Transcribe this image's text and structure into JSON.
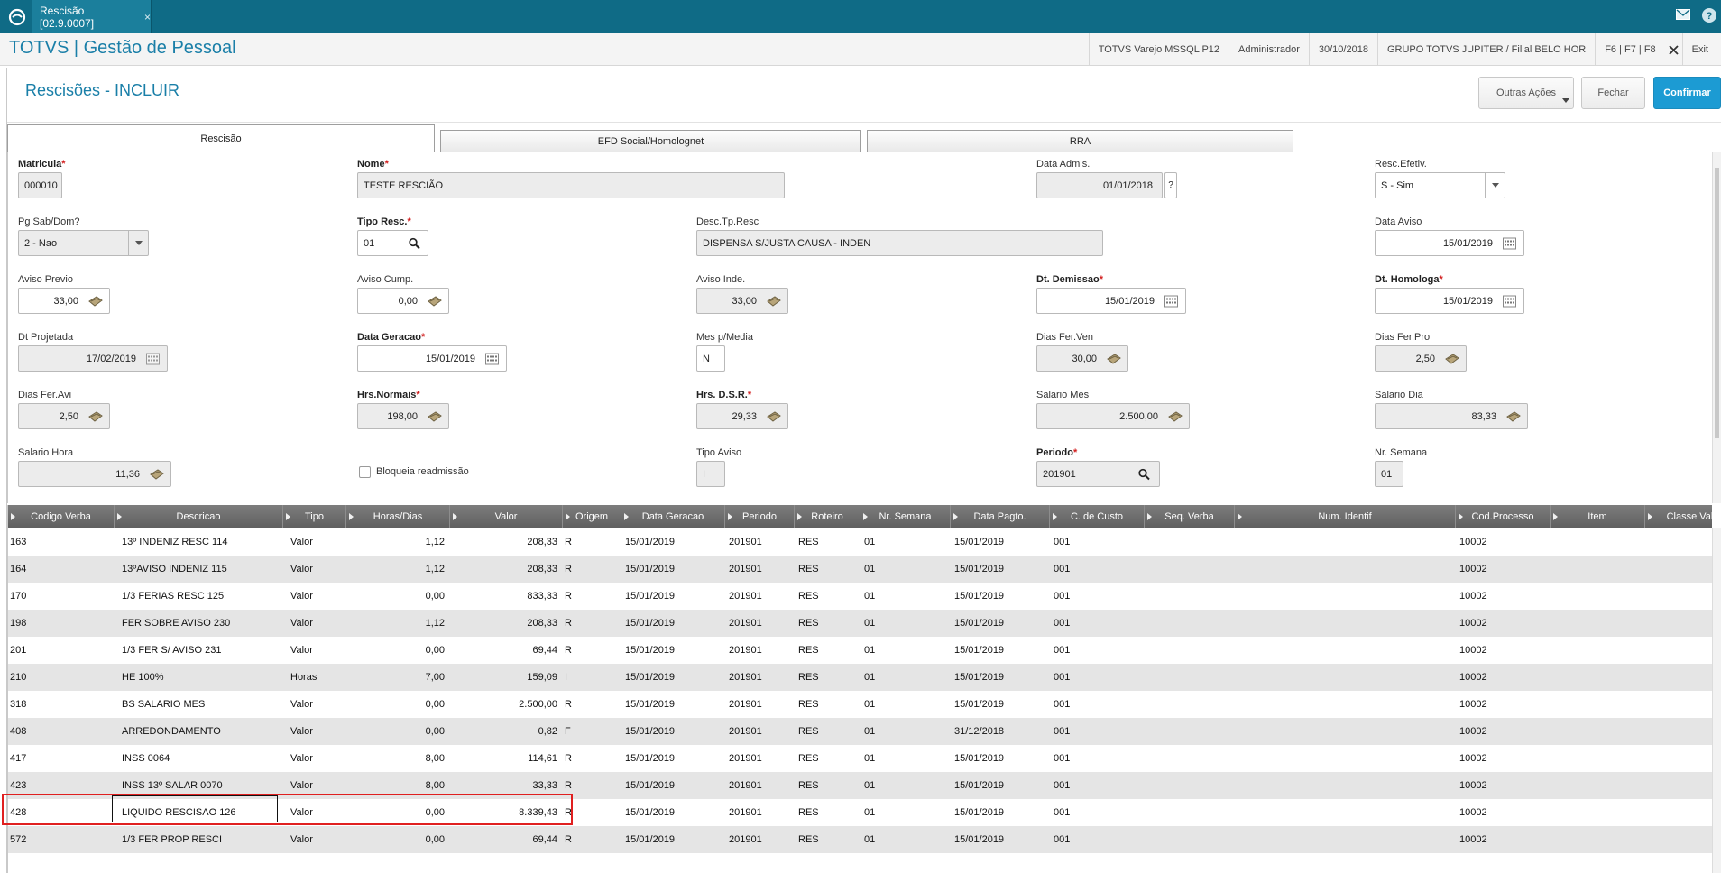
{
  "topbar": {
    "tab_label": "Rescisão [02.9.0007]",
    "tab_close": "×"
  },
  "header": {
    "app_title": "TOTVS | Gestão de Pessoal",
    "env": "TOTVS Varejo MSSQL P12",
    "user": "Administrador",
    "date": "30/10/2018",
    "company": "GRUPO TOTVS JUPITER / Filial BELO HOR",
    "keys": "F6 | F7 | F8",
    "exit": "Exit"
  },
  "page": {
    "title": "Rescisões - INCLUIR",
    "actions": {
      "more": "Outras Ações",
      "close": "Fechar",
      "confirm": "Confirmar"
    }
  },
  "tabs": [
    "Rescisão",
    "EFD Social/Homolognet",
    "RRA"
  ],
  "form": {
    "matricula": {
      "label": "Matricula",
      "value": "000010"
    },
    "nome": {
      "label": "Nome",
      "value": "TESTE RESCIÃO"
    },
    "data_admis": {
      "label": "Data Admis.",
      "value": "01/01/2018",
      "help": "?"
    },
    "resc_efetiv": {
      "label": "Resc.Efetiv.",
      "value": "S - Sim"
    },
    "pg_sab_dom": {
      "label": "Pg Sab/Dom?",
      "value": "2 - Nao"
    },
    "tipo_resc": {
      "label": "Tipo Resc.",
      "value": "01"
    },
    "desc_tp_resc": {
      "label": "Desc.Tp.Resc",
      "value": "DISPENSA S/JUSTA CAUSA - INDEN"
    },
    "data_aviso": {
      "label": "Data Aviso",
      "value": "15/01/2019"
    },
    "aviso_previo": {
      "label": "Aviso Previo",
      "value": "33,00"
    },
    "aviso_cump": {
      "label": "Aviso Cump.",
      "value": "0,00"
    },
    "aviso_inde": {
      "label": "Aviso Inde.",
      "value": "33,00"
    },
    "dt_demissao": {
      "label": "Dt. Demissao",
      "value": "15/01/2019"
    },
    "dt_homologa": {
      "label": "Dt. Homologa",
      "value": "15/01/2019"
    },
    "dt_projetada": {
      "label": "Dt Projetada",
      "value": "17/02/2019"
    },
    "data_geracao": {
      "label": "Data Geracao",
      "value": "15/01/2019"
    },
    "mes_p_media": {
      "label": "Mes p/Media",
      "value": "N"
    },
    "dias_fer_ven": {
      "label": "Dias Fer.Ven",
      "value": "30,00"
    },
    "dias_fer_pro": {
      "label": "Dias Fer.Pro",
      "value": "2,50"
    },
    "dias_fer_avi": {
      "label": "Dias Fer.Avi",
      "value": "2,50"
    },
    "hrs_normais": {
      "label": "Hrs.Normais",
      "value": "198,00"
    },
    "hrs_dsr": {
      "label": "Hrs. D.S.R.",
      "value": "29,33"
    },
    "salario_mes": {
      "label": "Salario Mes",
      "value": "2.500,00"
    },
    "salario_dia": {
      "label": "Salario Dia",
      "value": "83,33"
    },
    "salario_hora": {
      "label": "Salario Hora",
      "value": "11,36"
    },
    "bloqueia": {
      "label": "Bloqueia readmissão"
    },
    "tipo_aviso": {
      "label": "Tipo Aviso",
      "value": "I"
    },
    "periodo": {
      "label": "Periodo",
      "value": "201901"
    },
    "nr_semana": {
      "label": "Nr. Semana",
      "value": "01"
    }
  },
  "grid": {
    "columns": [
      "Codigo Verba",
      "Descricao",
      "Tipo",
      "Horas/Dias",
      "Valor",
      "Origem",
      "Data Geracao",
      "Periodo",
      "Roteiro",
      "Nr. Semana",
      "Data Pagto.",
      "C. de Custo",
      "Seq. Verba",
      "Num. Identif",
      "Cod.Processo",
      "Item",
      "Classe Val"
    ],
    "rows": [
      [
        "163",
        "13º INDENIZ RESC 114",
        "Valor",
        "1,12",
        "208,33",
        "R",
        "15/01/2019",
        "201901",
        "RES",
        "01",
        "15/01/2019",
        "001",
        "",
        "",
        "10002",
        "",
        ""
      ],
      [
        "164",
        "13ºAVISO INDENIZ 115",
        "Valor",
        "1,12",
        "208,33",
        "R",
        "15/01/2019",
        "201901",
        "RES",
        "01",
        "15/01/2019",
        "001",
        "",
        "",
        "10002",
        "",
        ""
      ],
      [
        "170",
        "1/3 FERIAS RESC 125",
        "Valor",
        "0,00",
        "833,33",
        "R",
        "15/01/2019",
        "201901",
        "RES",
        "01",
        "15/01/2019",
        "001",
        "",
        "",
        "10002",
        "",
        ""
      ],
      [
        "198",
        "FER SOBRE AVISO 230",
        "Valor",
        "1,12",
        "208,33",
        "R",
        "15/01/2019",
        "201901",
        "RES",
        "01",
        "15/01/2019",
        "001",
        "",
        "",
        "10002",
        "",
        ""
      ],
      [
        "201",
        "1/3 FER S/ AVISO 231",
        "Valor",
        "0,00",
        "69,44",
        "R",
        "15/01/2019",
        "201901",
        "RES",
        "01",
        "15/01/2019",
        "001",
        "",
        "",
        "10002",
        "",
        ""
      ],
      [
        "210",
        "HE 100%",
        "Horas",
        "7,00",
        "159,09",
        "I",
        "15/01/2019",
        "201901",
        "RES",
        "01",
        "15/01/2019",
        "001",
        "",
        "",
        "10002",
        "",
        ""
      ],
      [
        "318",
        "BS SALARIO MES",
        "Valor",
        "0,00",
        "2.500,00",
        "R",
        "15/01/2019",
        "201901",
        "RES",
        "01",
        "15/01/2019",
        "001",
        "",
        "",
        "10002",
        "",
        ""
      ],
      [
        "408",
        "ARREDONDAMENTO",
        "Valor",
        "0,00",
        "0,82",
        "F",
        "15/01/2019",
        "201901",
        "RES",
        "01",
        "31/12/2018",
        "001",
        "",
        "",
        "10002",
        "",
        ""
      ],
      [
        "417",
        "INSS 0064",
        "Valor",
        "8,00",
        "114,61",
        "R",
        "15/01/2019",
        "201901",
        "RES",
        "01",
        "15/01/2019",
        "001",
        "",
        "",
        "10002",
        "",
        ""
      ],
      [
        "423",
        "INSS 13º SALAR 0070",
        "Valor",
        "8,00",
        "33,33",
        "R",
        "15/01/2019",
        "201901",
        "RES",
        "01",
        "15/01/2019",
        "001",
        "",
        "",
        "10002",
        "",
        ""
      ],
      [
        "428",
        "LIQUIDO RESCISAO 126",
        "Valor",
        "0,00",
        "8.339,43",
        "R",
        "15/01/2019",
        "201901",
        "RES",
        "01",
        "15/01/2019",
        "001",
        "",
        "",
        "10002",
        "",
        ""
      ],
      [
        "572",
        "1/3 FER PROP RESCI",
        "Valor",
        "0,00",
        "69,44",
        "R",
        "15/01/2019",
        "201901",
        "RES",
        "01",
        "15/01/2019",
        "001",
        "",
        "",
        "10002",
        "",
        ""
      ]
    ]
  },
  "colors": {
    "topbar": "#0f6b86",
    "title": "#1a7fa8",
    "confirm": "#1c9bd3",
    "highlight": "#e02020",
    "required": "#d21f1f"
  },
  "icons": [
    "totvs-logo-icon",
    "mail-icon",
    "help-icon",
    "search-icon",
    "calendar-icon",
    "calculator-icon",
    "dropdown-icon"
  ]
}
